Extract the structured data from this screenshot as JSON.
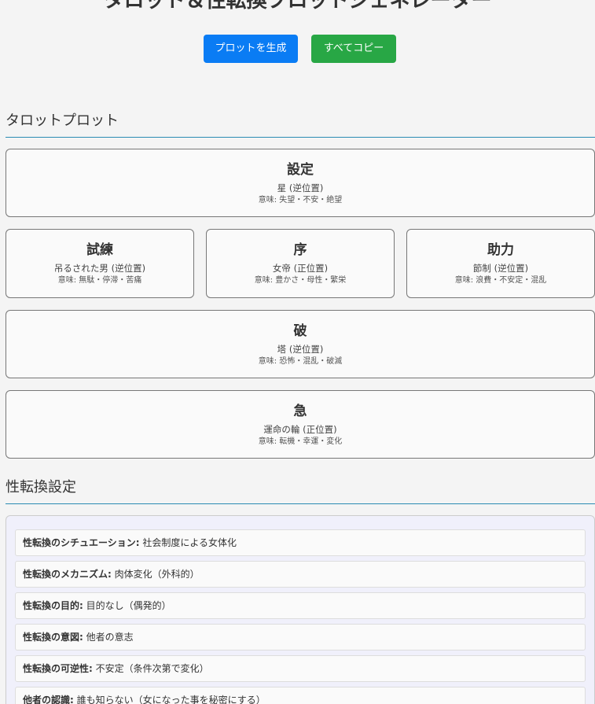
{
  "app": {
    "title": "タロット＆性転換プロットジェネレーター"
  },
  "toolbar": {
    "generate_label": "プロットを生成",
    "copy_label": "すべてコピー"
  },
  "sections": {
    "tarot_title": "タロットプロット",
    "gender_title": "性転換設定"
  },
  "cards": {
    "setting": {
      "title": "設定",
      "card": "星 (逆位置)",
      "meaning": "意味: 失望・不安・絶望"
    },
    "shiren": {
      "title": "試練",
      "card": "吊るされた男 (逆位置)",
      "meaning": "意味: 無駄・停滞・苦痛"
    },
    "jo": {
      "title": "序",
      "card": "女帝 (正位置)",
      "meaning": "意味: 豊かさ・母性・繁栄"
    },
    "joryoku": {
      "title": "助力",
      "card": "節制 (逆位置)",
      "meaning": "意味: 浪費・不安定・混乱"
    },
    "ha": {
      "title": "破",
      "card": "塔 (逆位置)",
      "meaning": "意味: 恐怖・混乱・破滅"
    },
    "kyu": {
      "title": "急",
      "card": "運命の輪 (正位置)",
      "meaning": "意味: 転機・幸運・変化"
    }
  },
  "gender": {
    "items": [
      {
        "label": "性転換のシチュエーション:",
        "value": "社会制度による女体化"
      },
      {
        "label": "性転換のメカニズム:",
        "value": "肉体変化（外科的）"
      },
      {
        "label": "性転換の目的:",
        "value": "目的なし（偶発的）"
      },
      {
        "label": "性転換の意図:",
        "value": "他者の意志"
      },
      {
        "label": "性転換の可逆性:",
        "value": "不安定（条件次第で変化）"
      },
      {
        "label": "他者の認識:",
        "value": "誰も知らない（女になった事を秘密にする）"
      }
    ]
  },
  "colors": {
    "generate_button": "#0a7cf4",
    "copy_button": "#28a745",
    "section_underline": "#2a8bb3",
    "gender_panel_bg": "#f0f0fb"
  }
}
